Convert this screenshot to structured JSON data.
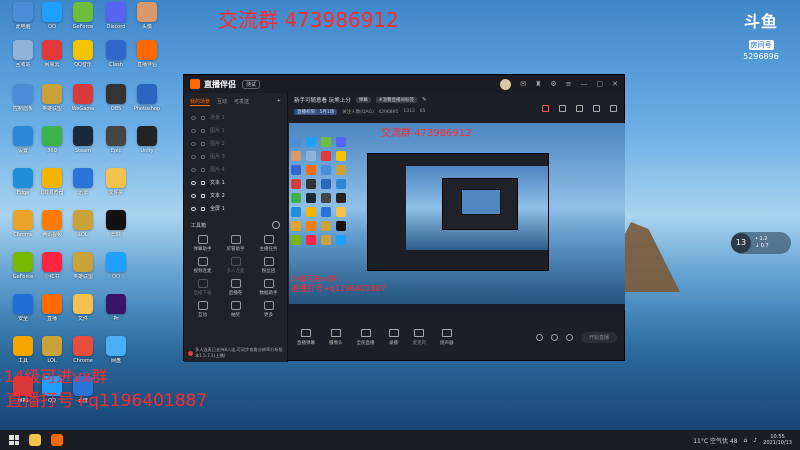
{
  "overlay": {
    "top_text": "交流群 473986912",
    "bottom_line1": "14级可进vx群",
    "bottom_line2": "直播打号+q1196401887"
  },
  "douyu": {
    "logo": "斗鱼",
    "tag": "房间号",
    "room_id": "5296896"
  },
  "weather_widget": {
    "temp": "13",
    "line1": "• 1.2",
    "line2": "↓ 0.7"
  },
  "desktop_icons": [
    {
      "label": "此电脑",
      "color": "#4a8fd6"
    },
    {
      "label": "QQ",
      "color": "#1fa0ff"
    },
    {
      "label": "GeForce",
      "color": "#6bbf3a"
    },
    {
      "label": "Discord",
      "color": "#5865f2"
    },
    {
      "label": "头像",
      "color": "#d99a6b"
    },
    {
      "label": "回收站",
      "color": "#8fb3d6"
    },
    {
      "label": "网易云",
      "color": "#e23a3a"
    },
    {
      "label": "QQ音乐",
      "color": "#f5c400"
    },
    {
      "label": "Clash",
      "color": "#3366cc"
    },
    {
      "label": "直播伴侣",
      "color": "#ff6a00"
    },
    {
      "label": "控制面板",
      "color": "#4a8fd6"
    },
    {
      "label": "英雄联盟",
      "color": "#c9a23a"
    },
    {
      "label": "WeGame",
      "color": "#d83a3a"
    },
    {
      "label": "OBS",
      "color": "#333"
    },
    {
      "label": "Photoshop",
      "color": "#2a66c0"
    },
    {
      "label": "设置",
      "color": "#2b88d8"
    },
    {
      "label": "360",
      "color": "#3bb34a"
    },
    {
      "label": "Steam",
      "color": "#1b2838"
    },
    {
      "label": "Epic",
      "color": "#444"
    },
    {
      "label": "Unity",
      "color": "#222"
    },
    {
      "label": "Edge",
      "color": "#1e8fd8"
    },
    {
      "label": "QQ浏览器",
      "color": "#f5b400"
    },
    {
      "label": "迅雷",
      "color": "#2a73d8"
    },
    {
      "label": "文件夹",
      "color": "#f2c14e"
    },
    {
      "label": "Chrome",
      "color": "#e8a42a"
    },
    {
      "label": "腾讯视频",
      "color": "#ff7b00"
    },
    {
      "label": "LOL",
      "color": "#c9a23a"
    },
    {
      "label": "剪映",
      "color": "#111"
    },
    {
      "label": "GeForce",
      "color": "#76b900"
    },
    {
      "label": "小红书",
      "color": "#ff2442"
    },
    {
      "label": "英雄联盟",
      "color": "#c9a23a"
    },
    {
      "label": "QQ",
      "color": "#1fa0ff"
    },
    {
      "label": "安全",
      "color": "#1f6fd6"
    },
    {
      "label": "直播",
      "color": "#ff6a00"
    },
    {
      "label": "文件",
      "color": "#f2c14e"
    },
    {
      "label": "Pr",
      "color": "#3a1466"
    },
    {
      "label": "工具",
      "color": "#f5a400"
    },
    {
      "label": "LOL",
      "color": "#c9a23a"
    },
    {
      "label": "Chrome",
      "color": "#e84c3d"
    },
    {
      "label": "网盘",
      "color": "#4ab0f5"
    },
    {
      "label": "WPS",
      "color": "#d83a3a"
    },
    {
      "label": "QQ",
      "color": "#1fa0ff"
    },
    {
      "label": "百度",
      "color": "#2a73d8"
    }
  ],
  "app": {
    "name": "直播伴侣",
    "badge": "测试",
    "left_tabs": [
      "我的场景",
      "互动",
      "可发送"
    ],
    "left_plus": "+",
    "scenes": [
      {
        "label": "场景 1",
        "on": false
      },
      {
        "label": "图片 1",
        "on": false
      },
      {
        "label": "图片 2",
        "on": false
      },
      {
        "label": "图片 3",
        "on": false
      },
      {
        "label": "图片 4",
        "on": false
      },
      {
        "label": "文本 1",
        "on": true
      },
      {
        "label": "文本 2",
        "on": true
      },
      {
        "label": "全屏 1",
        "on": true
      }
    ],
    "tools_title": "工具箱",
    "tools": [
      {
        "label": "弹幕助手",
        "dim": false
      },
      {
        "label": "房管助手",
        "dim": false
      },
      {
        "label": "主播任务",
        "dim": false
      },
      {
        "label": "视频连麦",
        "dim": false
      },
      {
        "label": "多人连麦",
        "dim": true
      },
      {
        "label": "粉丝团",
        "dim": false
      },
      {
        "label": "直播下载",
        "dim": true
      },
      {
        "label": "直播券",
        "dim": false
      },
      {
        "label": "数据助手",
        "dim": false
      },
      {
        "label": "互动",
        "dim": false
      },
      {
        "label": "抽奖",
        "dim": false
      },
      {
        "label": "更多",
        "dim": false
      }
    ],
    "notice": "多人连麦已支持8人连,可同步查看分辨率分析版本1.5.7.1(上播)",
    "room": {
      "title": "新手可随意看 玩熊上分",
      "tag": "弹幕",
      "tag2": "#温馨直播间标签",
      "stat1": "直播权限：5月1场",
      "stat2": "关注人数(QAG)：4296895",
      "stat3": "1313",
      "stat4": "65"
    },
    "preview": {
      "top_text": "交流群 473986912",
      "mid1": "14级可进vx群",
      "mid2": "直播打号+q1196401887"
    },
    "bottom": [
      {
        "label": "直播弹幕",
        "off": false
      },
      {
        "label": "摄像头",
        "off": false
      },
      {
        "label": "全民直播",
        "off": false
      },
      {
        "label": "录播",
        "off": false
      },
      {
        "label": "麦克风",
        "off": true
      },
      {
        "label": "扬声器",
        "off": false
      }
    ],
    "start_label": "开始直播"
  },
  "taskbar": {
    "tray_weather": "11°C 空气优 48",
    "time": "10:55",
    "date": "2021/10/13"
  }
}
